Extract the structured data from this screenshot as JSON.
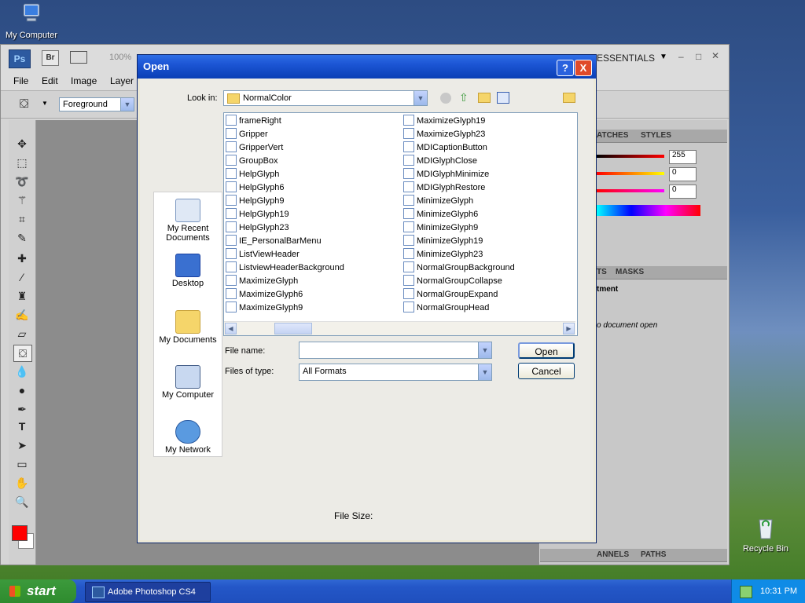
{
  "desktop": {
    "icons": [
      {
        "label": "My Computer"
      },
      {
        "label": "Recycle Bin"
      }
    ]
  },
  "photoshop": {
    "logo": "Ps",
    "bridge": "Br",
    "zoom": "100%",
    "workspace": "ESSENTIALS",
    "menus": [
      "File",
      "Edit",
      "Image",
      "Layer"
    ],
    "options": {
      "fill_source": "Foreground"
    },
    "panels": {
      "tabs_top": [
        "ATCHES",
        "STYLES"
      ],
      "color_values": [
        "255",
        "0",
        "0"
      ],
      "tabs_mid": [
        "TS",
        "MASKS"
      ],
      "adjustments_title": "tment",
      "adjustments_msg": "o document open",
      "tabs_bottom": [
        "ANNELS",
        "PATHS"
      ]
    },
    "colors": {
      "foreground": "#ff0000",
      "background": "#ffffff"
    }
  },
  "dialog": {
    "title": "Open",
    "help_button": "?",
    "close_button": "X",
    "look_in_label": "Look in:",
    "look_in_value": "NormalColor",
    "places": [
      {
        "label": "My Recent Documents",
        "icon": "recent-documents-icon"
      },
      {
        "label": "Desktop",
        "icon": "desktop-icon"
      },
      {
        "label": "My Documents",
        "icon": "my-documents-icon"
      },
      {
        "label": "My Computer",
        "icon": "my-computer-icon"
      },
      {
        "label": "My Network",
        "icon": "my-network-icon"
      }
    ],
    "files_col1": [
      "frameRight",
      "Gripper",
      "GripperVert",
      "GroupBox",
      "HelpGlyph",
      "HelpGlyph6",
      "HelpGlyph9",
      "HelpGlyph19",
      "HelpGlyph23",
      "IE_PersonalBarMenu",
      "ListViewHeader",
      "ListviewHeaderBackground",
      "MaximizeGlyph",
      "MaximizeGlyph6",
      "MaximizeGlyph9"
    ],
    "files_col2": [
      "MaximizeGlyph19",
      "MaximizeGlyph23",
      "MDICaptionButton",
      "MDIGlyphClose",
      "MDIGlyphMinimize",
      "MDIGlyphRestore",
      "MinimizeGlyph",
      "MinimizeGlyph6",
      "MinimizeGlyph9",
      "MinimizeGlyph19",
      "MinimizeGlyph23",
      "NormalGroupBackground",
      "NormalGroupCollapse",
      "NormalGroupExpand",
      "NormalGroupHead"
    ],
    "file_name_label": "File name:",
    "file_name_value": "",
    "files_of_type_label": "Files of type:",
    "files_of_type_value": "All Formats",
    "open_button": "Open",
    "cancel_button": "Cancel",
    "file_size_label": "File Size:"
  },
  "taskbar": {
    "start_label": "start",
    "task_label": "Adobe Photoshop CS4",
    "clock": "10:31 PM"
  }
}
